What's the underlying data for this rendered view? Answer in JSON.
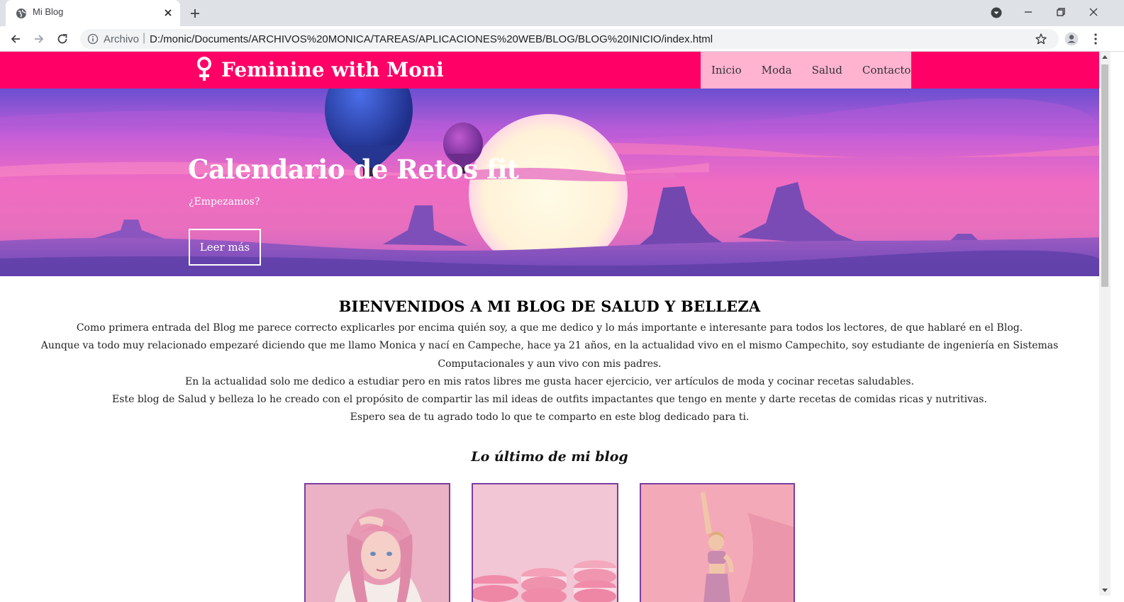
{
  "browser": {
    "tab_title": "Mi Blog",
    "address_prefix": "Archivo",
    "address_separator": "|",
    "url": "D:/monic/Documents/ARCHIVOS%20MONICA/TAREAS/APLICACIONES%20WEB/BLOG/BLOG%20INICIO/index.html"
  },
  "site": {
    "brand": "Feminine with Moni",
    "brand_icon": "female-symbol-icon",
    "colors": {
      "header": "#ff0066",
      "nav_bg": "#ffb3cf",
      "card_border": "#7a3ea0"
    },
    "nav": [
      {
        "label": "Inicio"
      },
      {
        "label": "Moda"
      },
      {
        "label": "Salud"
      },
      {
        "label": "Contacto"
      }
    ]
  },
  "hero": {
    "title": "Calendario de Retos fit",
    "subtitle": "¿Empezamos?",
    "button": "Leer más"
  },
  "welcome": {
    "heading": "BIENVENIDOS A MI BLOG DE SALUD Y BELLEZA",
    "paragraphs": [
      "Como primera entrada del Blog me parece correcto explicarles por encima quién soy, a que me dedico y lo más importante e interesante para todos los lectores, de que hablaré en el Blog.",
      "Aunque va todo muy relacionado empezaré diciendo que me llamo Monica y nací en Campeche, hace ya 21 años, en la actualidad vivo en el mismo Campechito, soy estudiante de ingeniería en Sistemas Computacionales y aun vivo con mis padres.",
      "En la actualidad solo me dedico a estudiar pero en mis ratos libres me gusta hacer ejercicio, ver artículos de moda y cocinar recetas saludables.",
      "Este blog de Salud y belleza lo he creado con el propósito de compartir las mil ideas de outfits impactantes que tengo en mente y darte recetas de comidas ricas y nutritivas.",
      "Espero sea de tu agrado todo lo que te comparto en este blog dedicado para ti."
    ]
  },
  "latest": {
    "title": "Lo último de mi blog"
  }
}
